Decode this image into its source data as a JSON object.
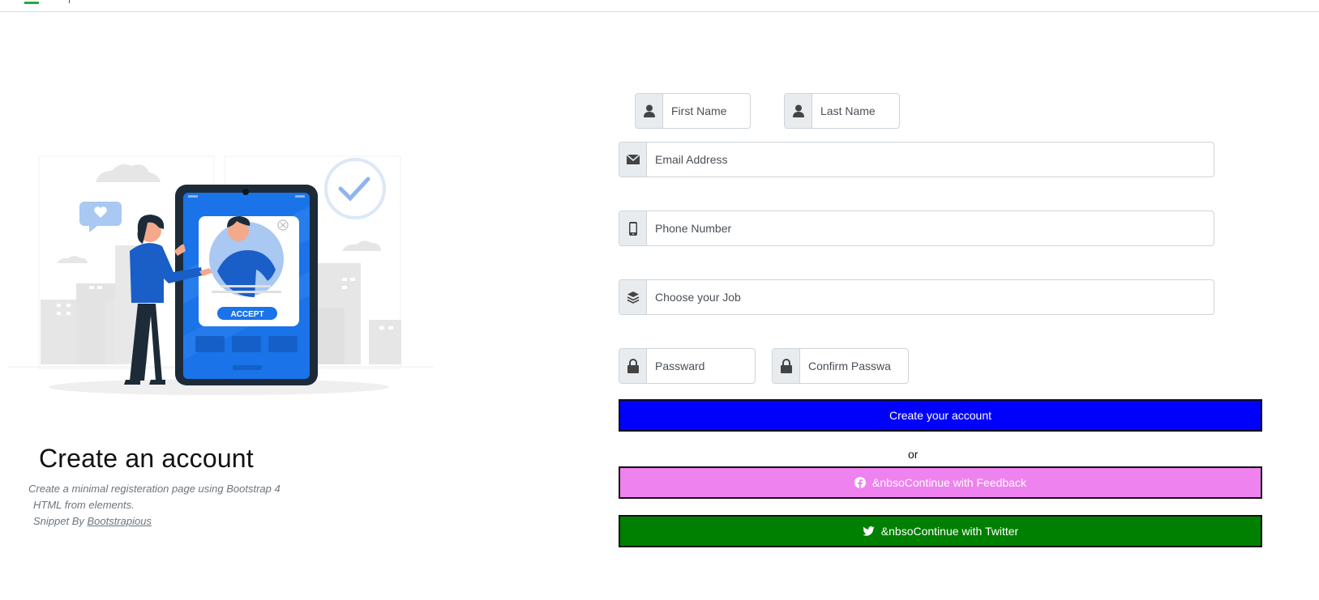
{
  "intro": {
    "heading": "Create an account",
    "desc_line1": "Create a minimal registeration page using Bootstrap 4",
    "desc_line2": "HTML from elements.",
    "desc_line3_prefix": "Snippet By ",
    "desc_link": "Bootstrapious"
  },
  "illustration": {
    "accept_label": "ACCEPT"
  },
  "form": {
    "first_name": {
      "placeholder": "First Name",
      "icon": "user-icon"
    },
    "last_name": {
      "placeholder": "Last Name",
      "icon": "user-icon"
    },
    "email": {
      "placeholder": "Email Address",
      "icon": "envelope-icon"
    },
    "phone": {
      "placeholder": "Phone Number",
      "icon": "phone-icon"
    },
    "job": {
      "placeholder": "Choose your Job",
      "icon": "layers-icon"
    },
    "password": {
      "placeholder": "Passward",
      "icon": "lock-icon"
    },
    "confirm": {
      "placeholder": "Confirm Passwa",
      "icon": "lock-icon"
    },
    "create_button": "Create your account",
    "or_label": "or",
    "facebook_button": "&nbsoContinue with Feedback",
    "twitter_button": "&nbsoContinue with Twitter"
  },
  "colors": {
    "create_button_bg": "#0000ff",
    "facebook_button_bg": "#ee82ee",
    "twitter_button_bg": "#008000",
    "illustration_accent": "#1a73e8"
  }
}
